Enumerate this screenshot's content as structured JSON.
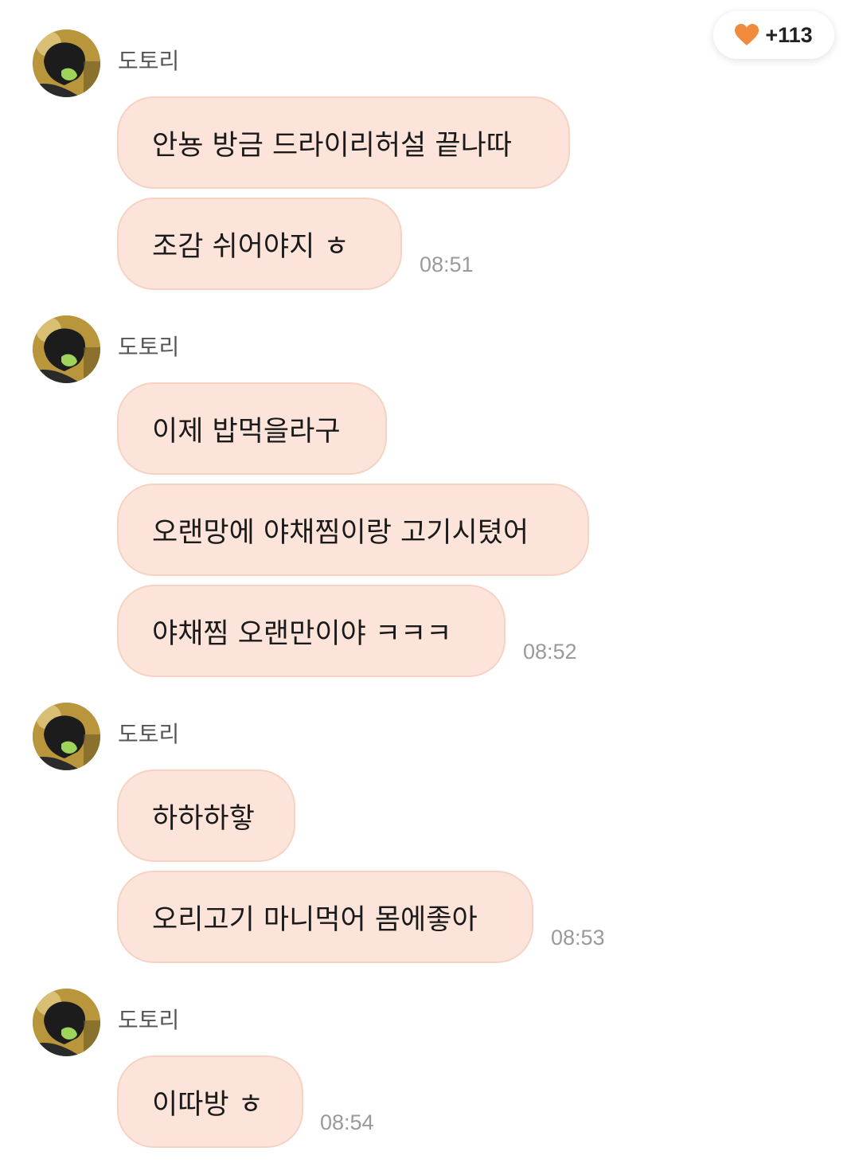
{
  "like_badge": {
    "icon": "heart-icon",
    "count": "+113",
    "heart_color": "#f08a3c"
  },
  "bubble_color": "#fce4da",
  "groups": [
    {
      "sender": "도토리",
      "messages": [
        "안뇽 방금 드라이리허설 끝나따",
        "조감 쉬어야지 ㅎ"
      ],
      "time": "08:51"
    },
    {
      "sender": "도토리",
      "messages": [
        "이제 밥먹을라구",
        "오랜망에 야채찜이랑 고기시텼어",
        "야채찜 오랜만이야 ㅋㅋㅋ"
      ],
      "time": "08:52"
    },
    {
      "sender": "도토리",
      "messages": [
        "하하하핳",
        "오리고기 마니먹어 몸에좋아"
      ],
      "time": "08:53"
    },
    {
      "sender": "도토리",
      "messages": [
        "이따방 ㅎ"
      ],
      "time": "08:54"
    }
  ]
}
